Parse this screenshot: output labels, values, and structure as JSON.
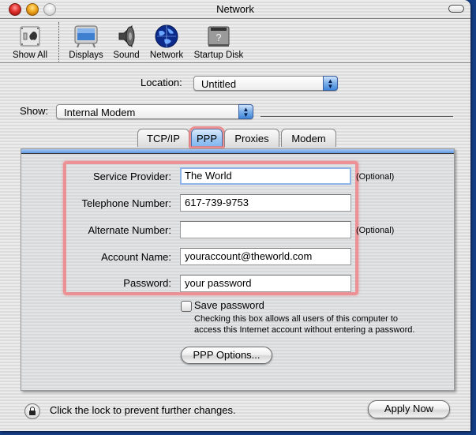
{
  "window": {
    "title": "Network"
  },
  "toolbar": {
    "items": [
      {
        "label": "Show All",
        "icon": "show-all-icon"
      },
      {
        "label": "Displays",
        "icon": "displays-icon"
      },
      {
        "label": "Sound",
        "icon": "sound-icon"
      },
      {
        "label": "Network",
        "icon": "network-icon"
      },
      {
        "label": "Startup Disk",
        "icon": "startup-disk-icon"
      }
    ]
  },
  "location": {
    "label": "Location:",
    "value": "Untitled"
  },
  "show": {
    "label": "Show:",
    "value": "Internal Modem"
  },
  "tabs": [
    {
      "label": "TCP/IP",
      "active": false
    },
    {
      "label": "PPP",
      "active": true
    },
    {
      "label": "Proxies",
      "active": false
    },
    {
      "label": "Modem",
      "active": false
    }
  ],
  "form": {
    "service_provider": {
      "label": "Service Provider:",
      "value": "The World",
      "note": "(Optional)"
    },
    "telephone_number": {
      "label": "Telephone Number:",
      "value": "617-739-9753"
    },
    "alternate_number": {
      "label": "Alternate Number:",
      "value": "",
      "note": "(Optional)"
    },
    "account_name": {
      "label": "Account Name:",
      "value": "youraccount@theworld.com"
    },
    "password": {
      "label": "Password:",
      "value": "your password"
    }
  },
  "save_password": {
    "label": "Save password",
    "checked": false,
    "help_line1": "Checking this box allows all users of this computer to",
    "help_line2": "access this Internet account without entering a password."
  },
  "buttons": {
    "ppp_options": "PPP Options...",
    "apply_now": "Apply Now"
  },
  "lock": {
    "text": "Click the lock to prevent further changes."
  },
  "colors": {
    "focus_ring": "#f07a7d",
    "accent": "#5f98e0",
    "desktop": "#143e86"
  }
}
